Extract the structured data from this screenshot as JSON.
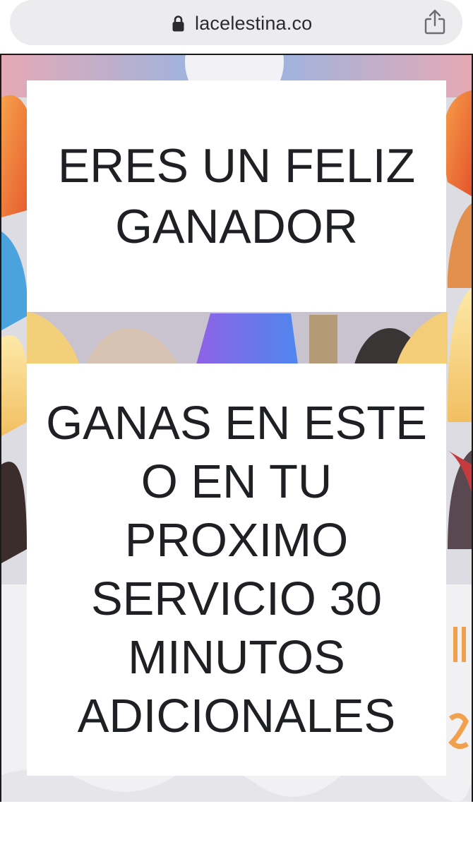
{
  "browser": {
    "url": "lacelestina.co",
    "icons": {
      "lock": "lock-icon",
      "share": "share-icon"
    }
  },
  "popup": {
    "headline": "ERES UN FELIZ GANADOR",
    "message": "GANAS EN ESTE O EN TU PROXIMO SERVICIO 30 MINUTOS ADICIONALES"
  },
  "colors": {
    "text": "#1f2024",
    "url_bar": "#ececee",
    "background_accent_orange": "#f07f3c",
    "background_accent_blue": "#6e7bf2",
    "background_accent_yellow": "#f5c96a"
  }
}
